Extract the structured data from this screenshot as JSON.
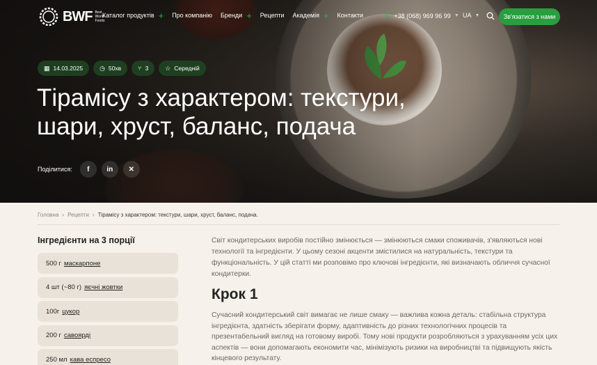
{
  "nav": {
    "logo_text": "BWF",
    "logo_sub": "Best World Foods",
    "menu": [
      {
        "label": "Каталог продуктів",
        "has_plus": true
      },
      {
        "label": "Про компанію",
        "has_plus": false
      },
      {
        "label": "Бренди",
        "has_plus": true
      },
      {
        "label": "Рецепти",
        "has_plus": false
      },
      {
        "label": "Академія",
        "has_plus": true
      },
      {
        "label": "Контакти",
        "has_plus": false
      }
    ],
    "phone": "+38 (068) 969 96 99",
    "language": "UA",
    "cta_label": "Зв'язатися з нами"
  },
  "hero": {
    "date": "14.03.2025",
    "time": "50хв",
    "servings": "3",
    "difficulty": "Середній",
    "title": "Тірамісу з характером: текстури, шари, хруст, баланс, подача",
    "share_label": "Поділитися:"
  },
  "breadcrumb": {
    "home": "Головна",
    "section": "Рецепти",
    "current": "Тірамісу з характером: текстури, шари, хруст, баланс, подача."
  },
  "ingredients": {
    "title": "Інгредієнти на 3 порції",
    "items": [
      {
        "qty": "500 г",
        "name": "маскарпоне"
      },
      {
        "qty": "4 шт (~80 г)",
        "name": "яєчні жовтки"
      },
      {
        "qty": "100г",
        "name": "цукор"
      },
      {
        "qty": "200 г",
        "name": "савоярді"
      },
      {
        "qty": "250 мл",
        "name": "кава еспресо"
      }
    ]
  },
  "article": {
    "intro": "Світ кондитерських виробів постійно змінюється — змінюються смаки споживачів, з'являються нові технології та інгредієнти. У цьому сезоні акценти змістилися на натуральність, текстури та функціональність. У цій статті ми розповімо про ключові інгредієнти, які визначають обличчя сучасної кондитерки.",
    "step_title": "Крок 1",
    "step_text": "Сучасний кондитерський світ вимагає не лише смаку — важлива кожна деталь: стабільна структура інгредієнта, здатність зберігати форму, адаптивність до різних технологічних процесів та презентабельний вигляд на готовому виробі. Тому нові продукти розробляються з урахуванням усіх цих аспектів — вони допомагають економити час, мінімізують ризики на виробництві та підвищують якість кінцевого результату."
  },
  "colors": {
    "accent": "#2a9d3f",
    "background": "#f6f1ea",
    "ingredient_bg": "#e9e2d8"
  }
}
